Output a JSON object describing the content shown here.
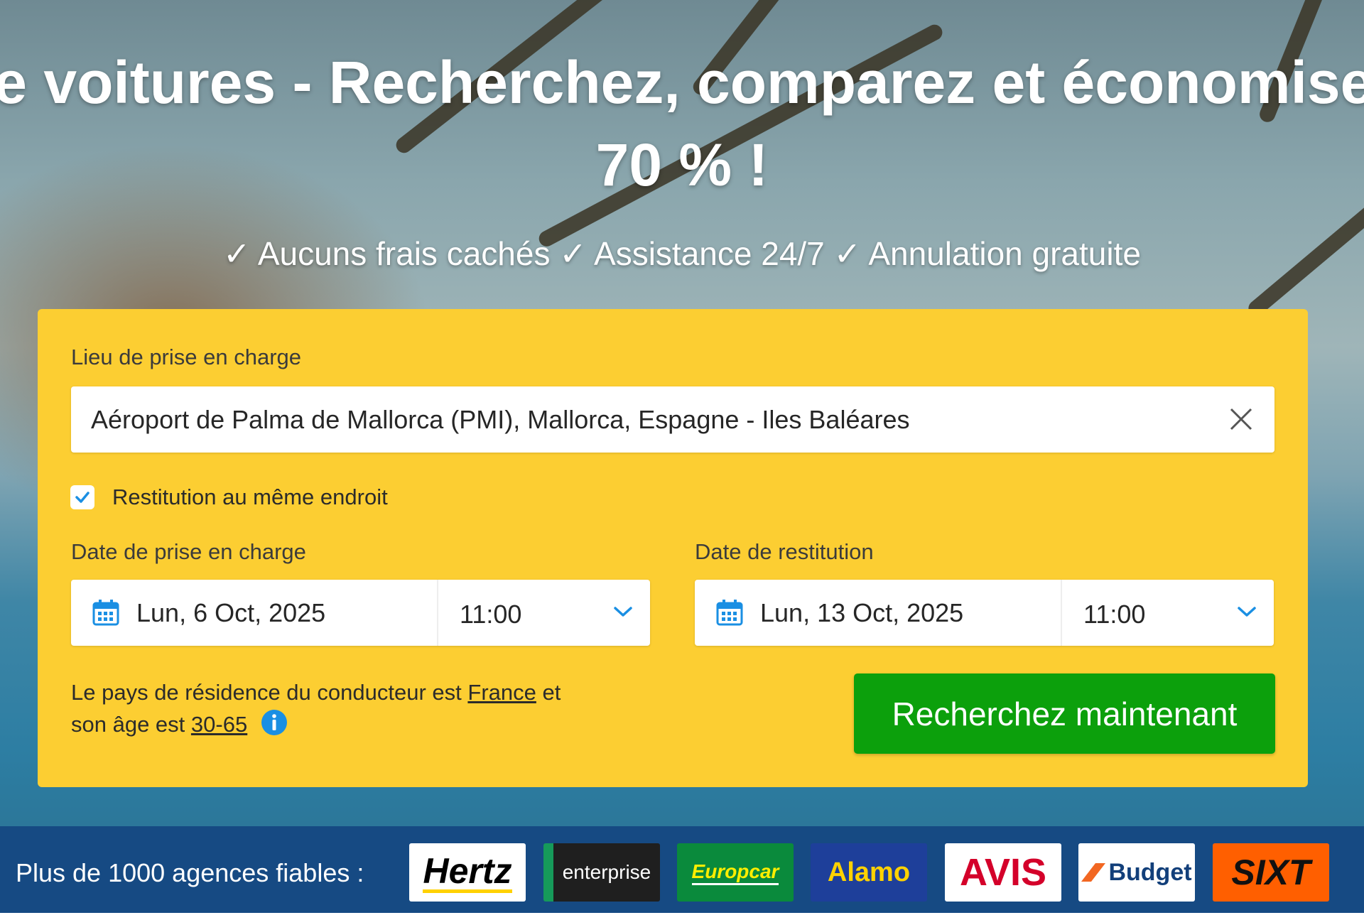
{
  "hero": {
    "title_line1": "de voitures - Recherchez, comparez et économisez",
    "title_line2": "70 % !",
    "benefits": "✓ Aucuns frais cachés ✓ Assistance 24/7 ✓ Annulation gratuite"
  },
  "search_form": {
    "pickup_location_label": "Lieu de prise en charge",
    "pickup_location_value": "Aéroport de Palma de Mallorca (PMI), Mallorca, Espagne - Iles Baléares",
    "same_location_label": "Restitution au même endroit",
    "same_location_checked": true,
    "pickup_date_label": "Date de prise en charge",
    "pickup_date": "Lun, 6 Oct, 2025",
    "pickup_time": "11:00",
    "return_date_label": "Date de restitution",
    "return_date": "Lun, 13 Oct, 2025",
    "return_time": "11:00",
    "residence_text_part1": "Le pays de résidence du conducteur est",
    "residence_country": "France",
    "residence_text_part2": "et",
    "age_text": "son âge est",
    "age_range": "30-65",
    "search_button": "Recherchez maintenant"
  },
  "partners": {
    "label": "Plus de 1000 agences fiables :",
    "logos": [
      {
        "name": "Hertz",
        "bg": "#ffffff",
        "fg": "#000000",
        "accent": "#ffd100"
      },
      {
        "name": "enterprise",
        "bg": "#1f1f1f",
        "fg": "#ffffff",
        "accent": "#169a5a"
      },
      {
        "name": "Europcar",
        "bg": "#0a8a3c",
        "fg": "#ffee00"
      },
      {
        "name": "Alamo",
        "bg": "#1e3f9a",
        "fg": "#ffd200"
      },
      {
        "name": "AVIS",
        "bg": "#ffffff",
        "fg": "#d4002a"
      },
      {
        "name": "Budget",
        "bg": "#ffffff",
        "fg": "#123f7a",
        "accent": "#f26722"
      },
      {
        "name": "SIXT",
        "bg": "#ff5f00",
        "fg": "#111111"
      }
    ]
  },
  "colors": {
    "panel": "#fcce32",
    "search_button": "#0ca00c",
    "partner_bar": "#164a83",
    "checkbox_accent": "#1a8fe3",
    "info_icon": "#1a8fe3"
  }
}
